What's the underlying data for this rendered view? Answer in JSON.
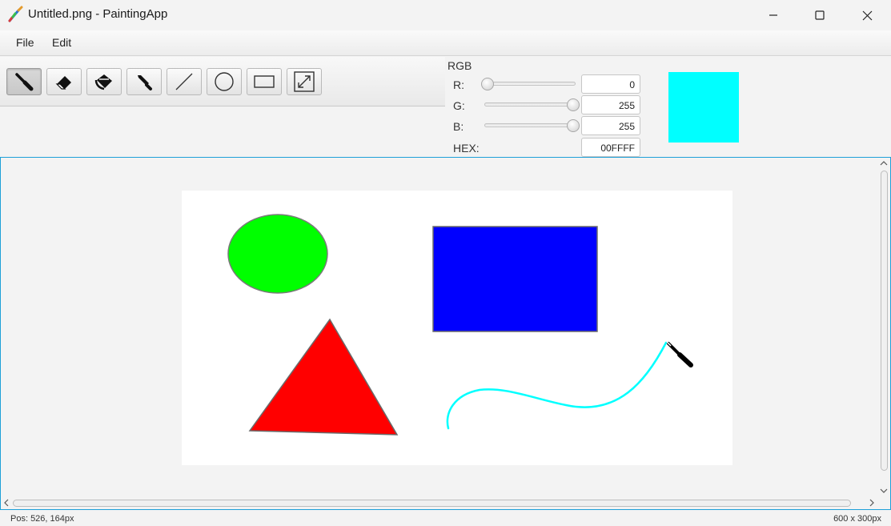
{
  "window": {
    "title": "Untitled.png - PaintingApp"
  },
  "menu": {
    "items": [
      "File",
      "Edit"
    ]
  },
  "tools": [
    {
      "name": "brush",
      "active": true
    },
    {
      "name": "eraser",
      "active": false
    },
    {
      "name": "fill",
      "active": false
    },
    {
      "name": "color-picker",
      "active": false
    },
    {
      "name": "line",
      "active": false
    },
    {
      "name": "ellipse",
      "active": false
    },
    {
      "name": "rectangle",
      "active": false
    },
    {
      "name": "resize",
      "active": false
    }
  ],
  "color_panel": {
    "heading": "RGB",
    "r_label": "R:",
    "g_label": "G:",
    "b_label": "B:",
    "hex_label": "HEX:",
    "r_value": "0",
    "g_value": "255",
    "b_value": "255",
    "hex_value": "00FFFF",
    "r_fraction": 0.0,
    "g_fraction": 1.0,
    "b_fraction": 1.0,
    "preview_color": "#00FFFF"
  },
  "canvas": {
    "shapes": [
      {
        "type": "ellipse",
        "fill": "#00FF00",
        "stroke": "#7a7a7a"
      },
      {
        "type": "rectangle",
        "fill": "#0000FF",
        "stroke": "#6a6a6a"
      },
      {
        "type": "triangle",
        "fill": "#FF0000",
        "stroke": "#6a6a6a"
      },
      {
        "type": "freehand-stroke",
        "stroke": "#00FFFF"
      }
    ]
  },
  "status": {
    "position": "Pos: 526, 164px",
    "size": "600 x 300px"
  },
  "colors": {
    "accent_border": "#1ea0d8",
    "window_bg": "#f3f3f3"
  }
}
